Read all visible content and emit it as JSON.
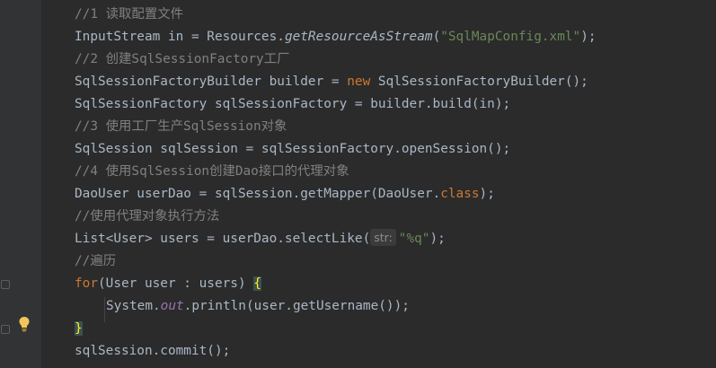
{
  "editor": {
    "lines": [
      {
        "comment": "//1 读取配置文件"
      },
      {
        "type": "InputStream in = Resources.",
        "method": "getResourceAsStream",
        "open": "(",
        "str": "\"SqlMapConfig.xml\"",
        "close": ");"
      },
      {
        "comment": "//2 创建SqlSessionFactory工厂"
      },
      {
        "pre": "SqlSessionFactoryBuilder builder = ",
        "kw": "new",
        "post": " SqlSessionFactoryBuilder();"
      },
      {
        "text": "SqlSessionFactory sqlSessionFactory = builder.build(in);"
      },
      {
        "comment": "//3 使用工厂生产SqlSession对象"
      },
      {
        "text": "SqlSession sqlSession = sqlSessionFactory.openSession();"
      },
      {
        "comment": "//4 使用SqlSession创建Dao接口的代理对象"
      },
      {
        "pre": "DaoUser userDao = sqlSession.getMapper(DaoUser.",
        "kw": "class",
        "post": ");"
      },
      {
        "comment": "//使用代理对象执行方法"
      },
      {
        "pre": "List<User> users = userDao.selectLike(",
        "hint": "str:",
        "str": "\"%q\"",
        "post": ");"
      },
      {
        "comment": "//遍历"
      },
      {
        "kw": "for",
        "pre": "(User user : users) ",
        "brace": "{"
      },
      {
        "pre": "System.",
        "field": "out",
        "post": ".println(user.getUsername());"
      },
      {
        "brace": "}"
      },
      {
        "text": "sqlSession.commit();"
      }
    ]
  },
  "colors": {
    "background": "#2b2b2b",
    "text": "#a9b7c6",
    "comment": "#808080",
    "keyword": "#cc7832",
    "string": "#6a8759",
    "field": "#9876aa",
    "brace_match": "#ffef28"
  },
  "icons": {
    "gutter_bulb": "lightbulb-icon",
    "fold_markers": "fold-marker-icon"
  }
}
